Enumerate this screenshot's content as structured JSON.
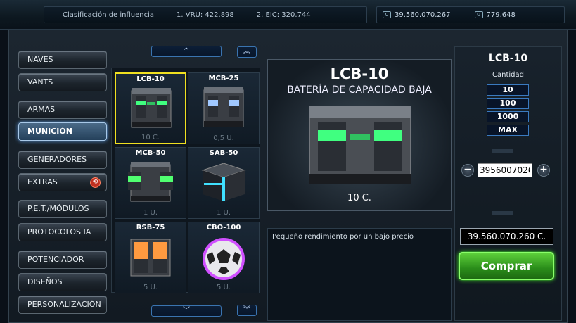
{
  "topbar": {
    "influence_label": "Clasificación de influencia",
    "rank1": "1. VRU: 422.898",
    "rank2": "2. EIC: 320.744",
    "credits": "39.560.070.267",
    "uridium": "779.648",
    "credits_icon": "credits-icon",
    "uridium_icon": "uridium-icon"
  },
  "menu": {
    "items": [
      {
        "label": "NAVES"
      },
      {
        "label": "VANTS"
      },
      {
        "label": "ARMAS"
      },
      {
        "label": "MUNICIÓN"
      },
      {
        "label": "GENERADORES"
      },
      {
        "label": "EXTRAS"
      },
      {
        "label": "P.E.T./MÓDULOS"
      },
      {
        "label": "PROTOCOLOS IA"
      },
      {
        "label": "POTENCIADOR"
      },
      {
        "label": "DISEÑOS"
      },
      {
        "label": "PERSONALIZACIÓN"
      }
    ],
    "active": "MUNICIÓN",
    "extras_badge_icon": "warning-icon"
  },
  "grid": {
    "items": [
      {
        "name": "LCB-10",
        "price": "10 C."
      },
      {
        "name": "MCB-25",
        "price": "0,5 U."
      },
      {
        "name": "MCB-50",
        "price": "1 U."
      },
      {
        "name": "SAB-50",
        "price": "1 U."
      },
      {
        "name": "RSB-75",
        "price": "5 U."
      },
      {
        "name": "CBO-100",
        "price": "5 U."
      }
    ],
    "scroll_up": "^",
    "scroll_top": "«",
    "scroll_down": "v",
    "scroll_bottom": "»"
  },
  "detail": {
    "code": "LCB-10",
    "title": "BATERÍA DE CAPACIDAD BAJA",
    "price": "10 C.",
    "description": "Pequeño rendimiento por un bajo precio"
  },
  "purchase": {
    "code": "LCB-10",
    "quantity_label": "Cantidad",
    "presets": [
      "10",
      "100",
      "1000",
      "MAX"
    ],
    "quantity_value": "3956007026",
    "minus": "−",
    "plus": "+",
    "total": "39.560.070.260 C.",
    "buy_label": "Comprar"
  },
  "colors": {
    "accent_green": "#5ccf3a",
    "selection_yellow": "#f0e020",
    "button_blue": "#3a7ac0"
  }
}
